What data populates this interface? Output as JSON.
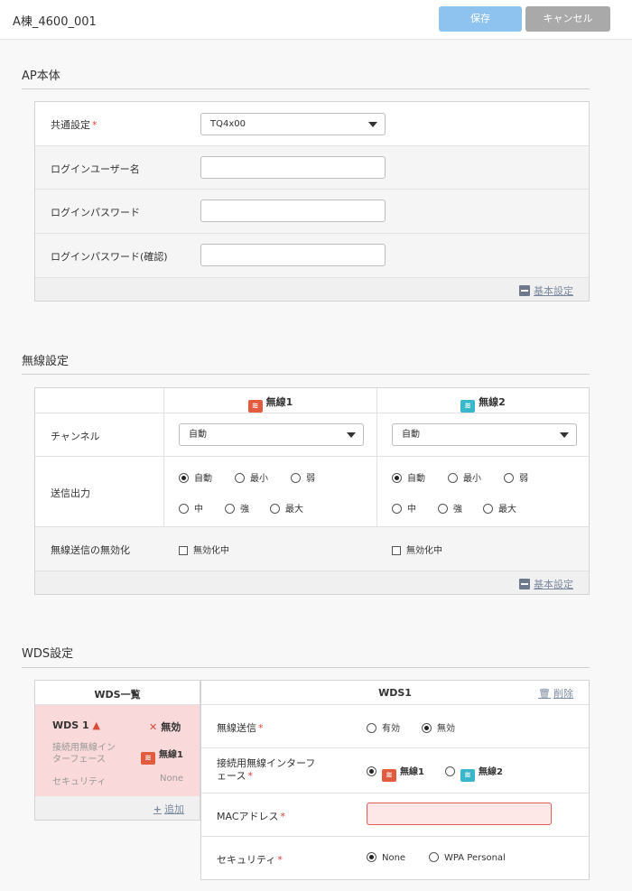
{
  "header": {
    "title": "A棟_4600_001",
    "save_label": "保存",
    "cancel_label": "キャンセル"
  },
  "ap": {
    "section_title": "AP本体",
    "rows": [
      {
        "label": "共通設定",
        "required": "*",
        "value": "TQ4x00"
      },
      {
        "label": "ログインユーザー名",
        "value": ""
      },
      {
        "label": "ログインパスワード",
        "value": ""
      },
      {
        "label": "ログインパスワード(確認)",
        "value": ""
      }
    ],
    "basic_link": "基本設定"
  },
  "wireless": {
    "section_title": "無線設定",
    "col1": "無線1",
    "col2": "無線2",
    "channel_label": "チャンネル",
    "channel1": "自動",
    "channel2": "自動",
    "power_label": "送信出力",
    "power_options": [
      "自動",
      "最小",
      "弱",
      "中",
      "強",
      "最大"
    ],
    "power_selected1": "自動",
    "power_selected2": "自動",
    "disable_label": "無線送信の無効化",
    "disable_opt": "無効化中",
    "basic_link": "基本設定"
  },
  "wds": {
    "section_title": "WDS設定",
    "list_title": "WDS一覧",
    "item": {
      "name": "WDS 1",
      "status": "無効",
      "if_label": "接続用無線インターフェース",
      "if_value": "無線1",
      "security_label": "セキュリティ",
      "security_value": "None"
    },
    "add_label": "追加",
    "detail_title": "WDS1",
    "delete_label": "削除",
    "tx_label": "無線送信",
    "tx_options": [
      "有効",
      "無効"
    ],
    "tx_selected": "無効",
    "if_label": "接続用無線インターフェース",
    "if_options": [
      "無線1",
      "無線2"
    ],
    "if_selected": "無線1",
    "mac_label": "MACアドレス",
    "mac_value": "",
    "security_label": "セキュリティ",
    "security_options": [
      "None",
      "WPA Personal"
    ],
    "security_selected": "None",
    "required": "*"
  },
  "colors": {
    "accent": "#8ec3ef",
    "error_bg": "#f9d9d9",
    "radio1": "#e35b3f",
    "radio2": "#37b7c9"
  }
}
